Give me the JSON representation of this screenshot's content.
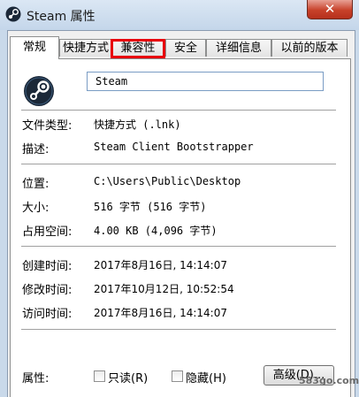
{
  "window": {
    "title": "Steam 属性",
    "close_label": "✕"
  },
  "tabs": [
    {
      "label": "常规",
      "active": true
    },
    {
      "label": "快捷方式"
    },
    {
      "label": "兼容性",
      "highlighted": true
    },
    {
      "label": "安全"
    },
    {
      "label": "详细信息"
    },
    {
      "label": "以前的版本"
    }
  ],
  "general": {
    "name_value": "Steam",
    "file_type_label": "文件类型:",
    "file_type_value": "快捷方式 (.lnk)",
    "description_label": "描述:",
    "description_value": "Steam Client Bootstrapper",
    "location_label": "位置:",
    "location_value": "C:\\Users\\Public\\Desktop",
    "size_label": "大小:",
    "size_value": "516 字节 (516 字节)",
    "disk_size_label": "占用空间:",
    "disk_size_value": "4.00 KB (4,096 字节)",
    "created_label": "创建时间:",
    "created_value": "2017年8月16日, 14:14:07",
    "modified_label": "修改时间:",
    "modified_value": "2017年10月12日, 10:52:54",
    "accessed_label": "访问时间:",
    "accessed_value": "2017年8月16日, 14:14:07",
    "attributes_label": "属性:",
    "readonly_label": "只读(R)",
    "hidden_label": "隐藏(H)",
    "advanced_label": "高级(D)..."
  },
  "colors": {
    "highlight": "#e8000b",
    "close": "#c7412a"
  },
  "watermark": "583go.com"
}
